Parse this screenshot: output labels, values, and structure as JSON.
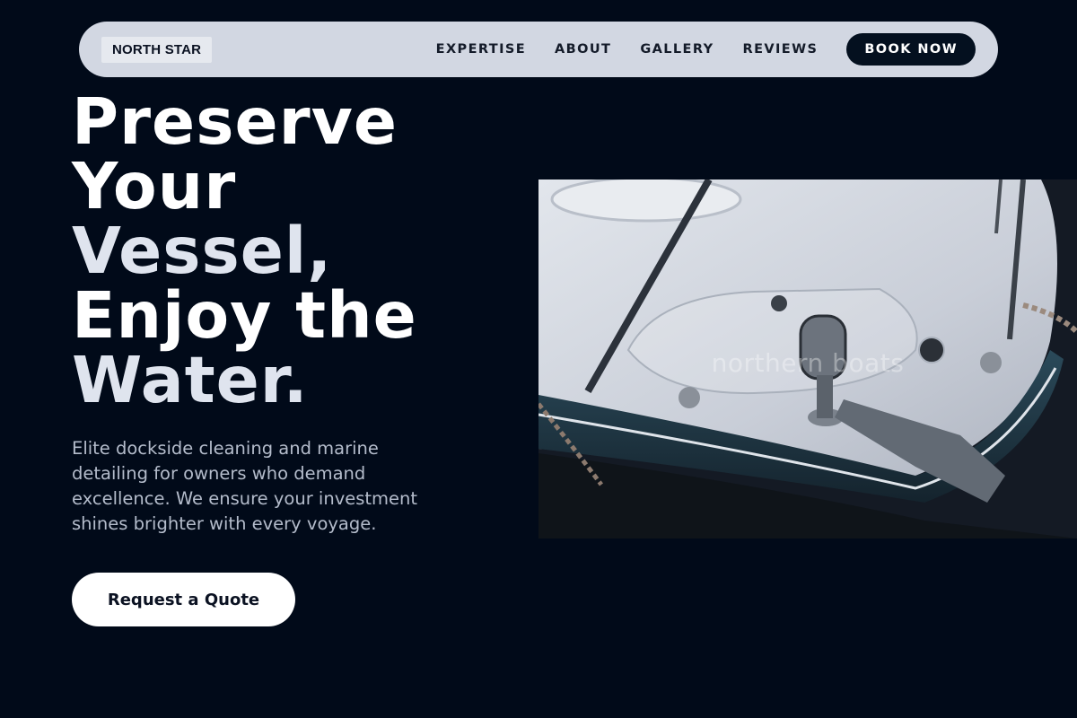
{
  "nav": {
    "logo": "NORTH STAR",
    "links": [
      "EXPERTISE",
      "ABOUT",
      "GALLERY",
      "REVIEWS"
    ],
    "cta": "BOOK NOW"
  },
  "hero": {
    "headline_line1": "Preserve",
    "headline_line2": "Your",
    "headline_line3": "Vessel,",
    "headline_line4": "Enjoy the",
    "headline_line5": "Water.",
    "subtext": "Elite dockside cleaning and marine detailing for owners who demand excellence. We ensure your investment shines brighter with every voyage.",
    "cta": "Request a Quote"
  },
  "image": {
    "subject": "boat-bow-photo",
    "watermark": "northern boats"
  },
  "colors": {
    "background": "#010a19",
    "nav_bg": "#d2d7e2",
    "button_dark": "#04101f",
    "text_light": "#ffffff",
    "subtext": "#b4bccb"
  }
}
